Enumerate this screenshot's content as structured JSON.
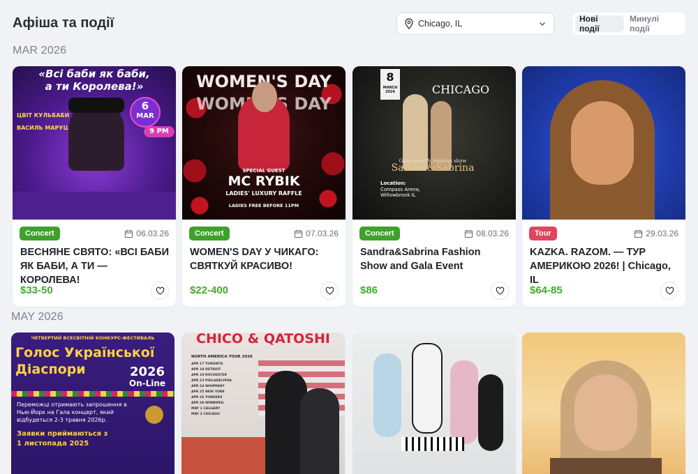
{
  "header": {
    "title": "Афіша та події",
    "location": "Chicago, IL",
    "tabs": [
      {
        "label": "Нові події",
        "active": true
      },
      {
        "label": "Минулі події",
        "active": false
      }
    ]
  },
  "sections": [
    {
      "label": "MAR 2026",
      "events": [
        {
          "badge": "Concert",
          "badge_color": "#3fa02c",
          "date": "06.03.26",
          "title": "ВЕСНЯНЕ СВЯТО: «ВСІ БАБИ ЯК БАБИ, А ТИ — КОРОЛЕВА!",
          "price": "$33-50",
          "poster_text": [
            "«Всі баби як баби,",
            "а ти Королева!»",
            "6",
            "MAR",
            "9 PM",
            "ЦВІТ КУЛЬБАБИ",
            "ВАСИЛЬ МАРУЩАК"
          ]
        },
        {
          "badge": "Concert",
          "badge_color": "#3fa02c",
          "date": "07.03.26",
          "title": "WOMEN'S DAY У ЧИКАГО: СВЯТКУЙ КРАСИВО!",
          "price": "$22-400",
          "poster_text": [
            "WOMEN'S DAY",
            "WOMEN'S DAY",
            "SPECIAL GUEST",
            "MC RYBIK",
            "LADIES' LUXURY RAFFLE",
            "LADIES FREE BEFORE 11PM"
          ]
        },
        {
          "badge": "Concert",
          "badge_color": "#3fa02c",
          "date": "08.03.26",
          "title": "Sandra&Sabrina Fashion Show and Gala Event",
          "price": "$86",
          "poster_text": [
            "8",
            "MARCH 2026",
            "CHICAGO",
            "Gala event & Fashion show",
            "Sandra&Sabrina",
            "Location:",
            "Compass Arena,",
            "Willowbrook IL"
          ]
        },
        {
          "badge": "Tour",
          "badge_color": "#e0455e",
          "date": "29.03.26",
          "title": "KAZKA. RAZOM. — ТУР АМЕРИКОЮ 2026! | Chicago, IL",
          "price": "$64-85",
          "poster_text": []
        }
      ]
    },
    {
      "label": "MAY 2026",
      "events": [
        {
          "poster_text": [
            "ЧЕТВЕРТИЙ ВСЕСВІТНІЙ КОНКУРС-ФЕСТИВАЛЬ",
            "Голос Української",
            "Діаспори",
            "2026",
            "On-Line",
            "Переможці отримають запрошення в Нью-Йорк на Гала концерт, який відбудеться 2-3 травня 2026р.",
            "Заявки приймаються з",
            "1 листопада 2025"
          ]
        },
        {
          "poster_text": [
            "CHICO & QATOSHI",
            "NORTH AMERICA TOUR 2026",
            "APR 17 TORONTO",
            "APR 18 DETROIT",
            "APR 19 ROCHESTER",
            "APR 23 PHILADELPHIA",
            "APR 24 WHIPPANY",
            "APR 25 NEW YORK",
            "APR 26 YONKERS",
            "APR 29 WINNIPEG",
            "MAY 1 CALGARY",
            "MAY 2 CHICAGO"
          ]
        },
        {
          "poster_text": []
        },
        {
          "poster_text": []
        }
      ]
    }
  ],
  "colors": {
    "price": "#3fae2a",
    "concert_badge": "#3fa02c",
    "tour_badge": "#e0455e",
    "background": "#f1f2f5"
  },
  "icons": {
    "location": "map-pin-icon",
    "dropdown": "chevron-down-icon",
    "date": "calendar-icon",
    "favorite": "heart-icon"
  }
}
